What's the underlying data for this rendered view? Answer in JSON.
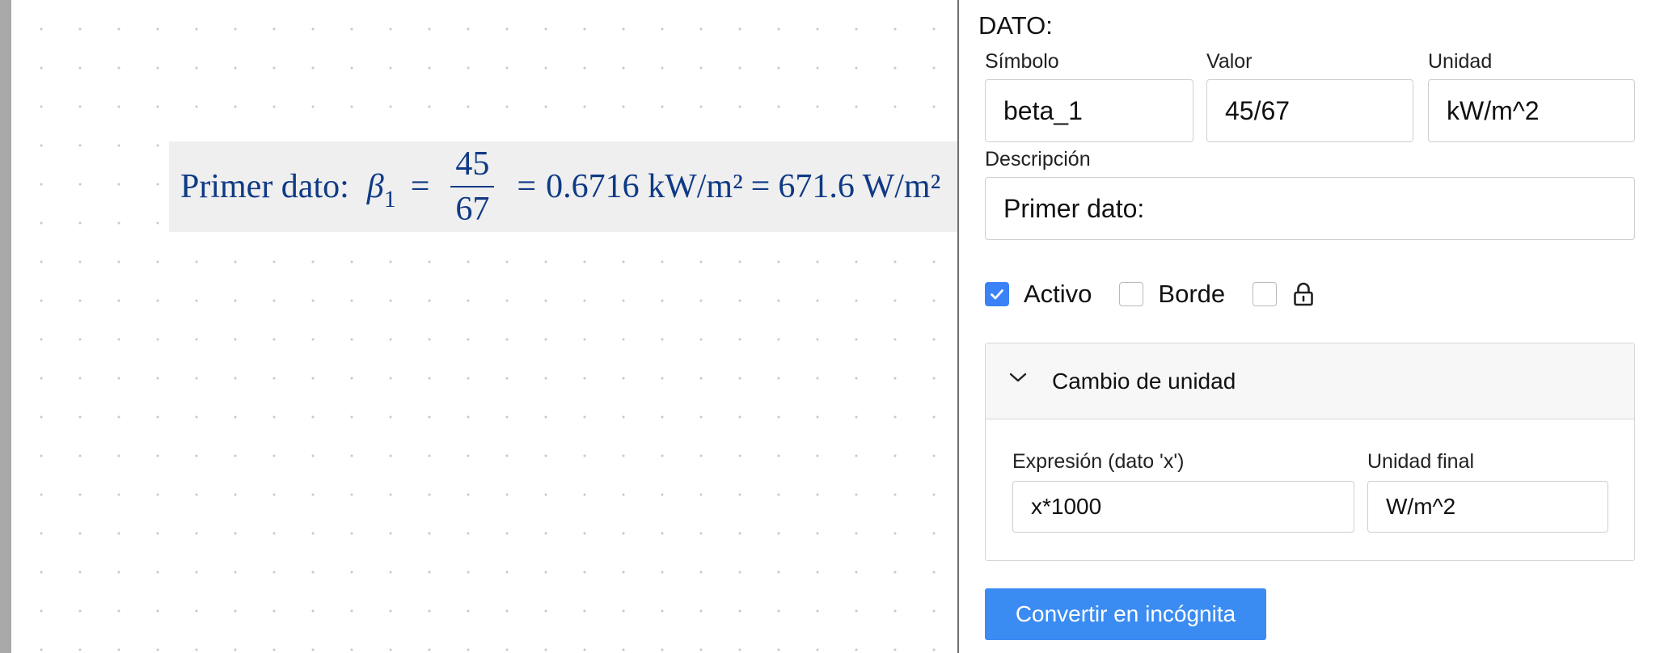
{
  "formula": {
    "description": "Primer dato:",
    "symbol": "β",
    "subscript": "1",
    "equals": "=",
    "numerator": "45",
    "denominator": "67",
    "decimal_value": "0.6716 kW/m²",
    "converted_value": "671.6 W/m²"
  },
  "panel": {
    "title": "DATO:",
    "symbol_label": "Símbolo",
    "symbol_value": "beta_1",
    "value_label": "Valor",
    "value_value": "45/67",
    "unit_label": "Unidad",
    "unit_value": "kW/m^2",
    "description_label": "Descripción",
    "description_value": "Primer dato:",
    "active_label": "Activo",
    "active_checked": true,
    "border_label": "Borde",
    "border_checked": false,
    "lock_checked": false,
    "accordion": {
      "title": "Cambio de unidad",
      "expression_label": "Expresión (dato 'x')",
      "expression_value": "x*1000",
      "final_unit_label": "Unidad final",
      "final_unit_value": "W/m^2"
    },
    "convert_button": "Convertir en incógnita"
  },
  "colors": {
    "formula_text": "#0f3a85",
    "accent": "#3b82f6",
    "button": "#3b8cf2"
  }
}
